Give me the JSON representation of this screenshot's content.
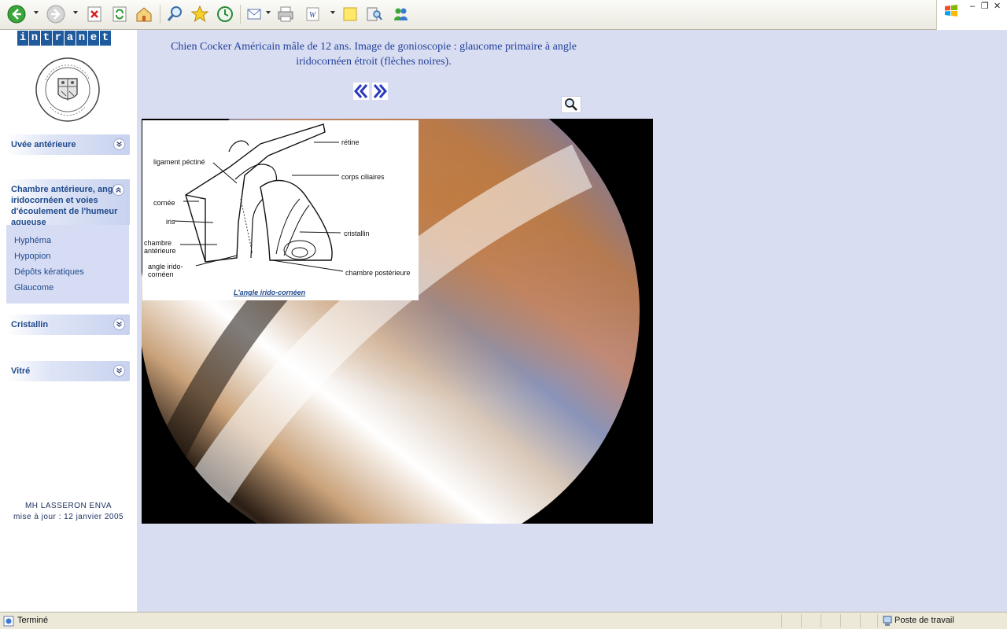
{
  "toolbar": {
    "buttons": [
      "back-icon",
      "forward-icon",
      "stop-icon",
      "refresh-icon",
      "home-icon",
      "search-icon",
      "favorites-icon",
      "history-icon",
      "mail-icon",
      "print-icon",
      "edit-icon",
      "discuss-icon",
      "research-icon",
      "messenger-icon"
    ]
  },
  "sidebar": {
    "intranet_letters": [
      "i",
      "n",
      "t",
      "r",
      "a",
      "n",
      "e",
      "t"
    ],
    "sections": [
      {
        "label": "Uvée antérieure"
      },
      {
        "label": "Chambre antérieure, angle iridocornéen et voies d'écoulement de l'humeur aqueuse"
      },
      {
        "label": "Cristallin"
      },
      {
        "label": "Vitré"
      }
    ],
    "subitems": [
      "Hyphéma",
      "Hypopion",
      "Dépôts kératiques",
      "Glaucome"
    ],
    "credit_author": "MH LASSERON ENVA",
    "credit_update": "mise à jour : 12 janvier 2005"
  },
  "main": {
    "caption": "Chien Cocker Américain mâle de 12 ans. Image de gonioscopie : glaucome primaire à angle iridocornéen étroit (flèches noires).",
    "diagram": {
      "labels": {
        "retine": "rétine",
        "ligament": "ligament péctiné",
        "corps_ciliaires": "corps ciliaires",
        "cornee": "cornée",
        "iris": "iris",
        "cristallin": "cristallin",
        "chambre_ant": "chambre antérieure",
        "angle": "angle irido-cornéen",
        "chambre_post": "chambre postérieure"
      },
      "title": "L'angle irido-cornéen"
    }
  },
  "statusbar": {
    "text": "Terminé",
    "zone": "Poste de travail"
  },
  "colors": {
    "accent": "#1f4a8c",
    "main_bg": "#d9ddf1",
    "panel": "#d6dcf4"
  }
}
